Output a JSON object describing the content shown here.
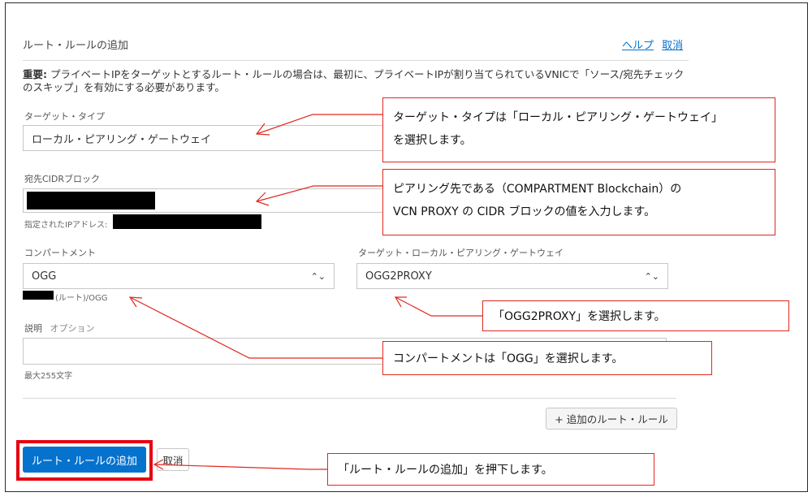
{
  "dialog": {
    "title": "ルート・ルールの追加",
    "help_link": "ヘルプ",
    "cancel_link": "取消",
    "notice_bold": "重要:",
    "notice_text": " プライベートIPをターゲットとするルート・ルールの場合は、最初に、プライベートIPが割り当てられているVNICで「ソース/宛先チェックのスキップ」を有効にする必要があります。"
  },
  "form": {
    "target_type_label": "ターゲット・タイプ",
    "target_type_value": "ローカル・ピアリング・ゲートウェイ",
    "dest_cidr_label": "宛先CIDRブロック",
    "specified_ip_label": "指定されたIPアドレス:",
    "compartment_label": "コンパートメント",
    "compartment_value": "OGG",
    "compartment_path": "(ルート)/OGG",
    "target_lpg_label": "ターゲット・ローカル・ピアリング・ゲートウェイ",
    "target_lpg_value": "OGG2PROXY",
    "description_label": "説明",
    "description_optional": "オプション",
    "description_help": "最大255文字",
    "add_another_rule": "+ 追加のルート・ルール",
    "submit_button": "ルート・ルールの追加",
    "cancel_button": "取消"
  },
  "callouts": {
    "target_type_line1": "ターゲット・タイプは「ローカル・ピアリング・ゲートウェイ」",
    "target_type_line2": "を選択します。",
    "cidr_line1": "ピアリング先である（COMPARTMENT Blockchain）の",
    "cidr_line2": "VCN PROXY の CIDR ブロックの値を入力します。",
    "lpg": "「OGG2PROXY」を選択します。",
    "compartment": "コンパートメントは「OGG」を選択します。",
    "submit": "「ルート・ルールの追加」を押下します。"
  },
  "colors": {
    "accent": "#0572ce",
    "callout_border": "#e0281f",
    "highlight_box": "#e60012"
  }
}
